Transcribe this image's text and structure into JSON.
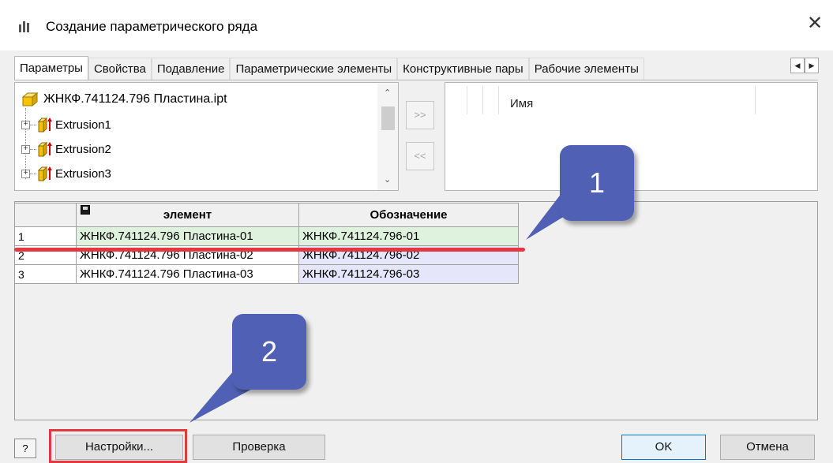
{
  "window": {
    "title": "Создание параметрического ряда",
    "close_glyph": "✕"
  },
  "tabs": [
    {
      "label": "Параметры",
      "active": true
    },
    {
      "label": "Свойства",
      "active": false
    },
    {
      "label": "Подавление",
      "active": false
    },
    {
      "label": "Параметрические элементы",
      "active": false
    },
    {
      "label": "Конструктивные пары",
      "active": false
    },
    {
      "label": "Рабочие элементы",
      "active": false
    }
  ],
  "tab_scroll": {
    "left": "◀",
    "right": "▶"
  },
  "tree": {
    "root": {
      "label": "ЖНКФ.741124.796 Пластина.ipt",
      "icon": "part-icon"
    },
    "items": [
      {
        "label": "Extrusion1",
        "icon": "extrusion-icon"
      },
      {
        "label": "Extrusion2",
        "icon": "extrusion-icon"
      },
      {
        "label": "Extrusion3",
        "icon": "extrusion-icon"
      }
    ]
  },
  "move_buttons": {
    "add": ">>",
    "remove": "<<"
  },
  "right_list": {
    "column_header": "Имя"
  },
  "grid": {
    "headers": {
      "element": "элемент",
      "designation": "Обозначение"
    },
    "rows": [
      {
        "num": "1",
        "element": "ЖНКФ.741124.796 Пластина-01",
        "designation": "ЖНКФ.741124.796-01"
      },
      {
        "num": "2",
        "element": "ЖНКФ.741124.796 Пластина-02",
        "designation": "ЖНКФ.741124.796-02"
      },
      {
        "num": "3",
        "element": "ЖНКФ.741124.796 Пластина-03",
        "designation": "ЖНКФ.741124.796-03"
      }
    ]
  },
  "callouts": {
    "first": "1",
    "second": "2"
  },
  "buttons": {
    "help": "?",
    "settings": "Настройки...",
    "check": "Проверка",
    "ok": "OK",
    "cancel": "Отмена"
  },
  "colors": {
    "callout": "#5060b4",
    "highlight": "#e63640",
    "selected_row": "#dff2dd",
    "designation_cell": "#e6e6fa"
  }
}
